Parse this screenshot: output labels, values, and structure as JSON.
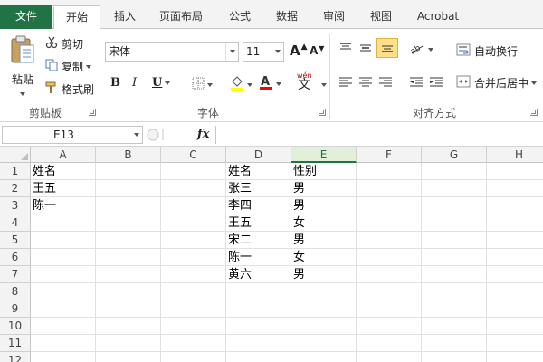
{
  "tabs": [
    "文件",
    "开始",
    "插入",
    "页面布局",
    "公式",
    "数据",
    "审阅",
    "视图",
    "Acrobat"
  ],
  "clipboard": {
    "paste_label": "粘贴",
    "cut_label": "剪切",
    "copy_label": "复制",
    "format_painter_label": "格式刷",
    "group_label": "剪贴板"
  },
  "font": {
    "name": "宋体",
    "size": "11",
    "bold": "B",
    "italic": "I",
    "underline": "U",
    "grow": "A",
    "shrink": "A",
    "phonetic": "wén",
    "phonetic_char": "文",
    "group_label": "字体",
    "highlight_color": "#ffff00",
    "font_color": "#ff0000"
  },
  "alignment": {
    "wrap_text_label": "自动换行",
    "merge_center_label": "合并后居中",
    "group_label": "对齐方式"
  },
  "formula_bar": {
    "name_box": "E13",
    "fx_label": "fx",
    "value": ""
  },
  "grid": {
    "columns": [
      "A",
      "B",
      "C",
      "D",
      "E",
      "F",
      "G",
      "H"
    ],
    "selected_column": "E",
    "rows": [
      "1",
      "2",
      "3",
      "4",
      "5",
      "6",
      "7",
      "8",
      "9",
      "10",
      "11",
      "12"
    ],
    "cells": {
      "A1": "姓名",
      "A2": "王五",
      "A3": "陈一",
      "D1": "姓名",
      "D2": "张三",
      "D3": "李四",
      "D4": "王五",
      "D5": "宋二",
      "D6": "陈一",
      "D7": "黄六",
      "E1": "性别",
      "E2": "男",
      "E3": "男",
      "E4": "女",
      "E5": "男",
      "E6": "女",
      "E7": "男"
    }
  },
  "colors": {
    "accent": "#217346",
    "selected_header_bg": "#e2efd9",
    "active_button_bg": "#ffe08a"
  }
}
